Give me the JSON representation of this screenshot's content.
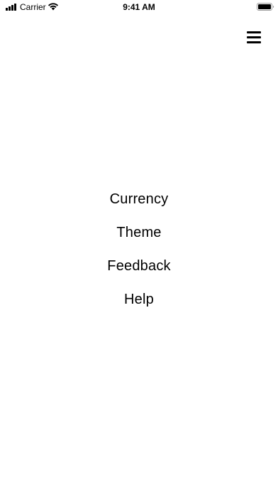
{
  "status_bar": {
    "carrier": "Carrier",
    "time": "9:41 AM",
    "icons": [
      "signal-icon",
      "wifi-icon",
      "battery-icon"
    ]
  },
  "header": {
    "menu_icon": "hamburger-menu-icon"
  },
  "menu": {
    "items": [
      {
        "label": "Currency"
      },
      {
        "label": "Theme"
      },
      {
        "label": "Feedback"
      },
      {
        "label": "Help"
      }
    ]
  },
  "colors": {
    "background": "#ffffff",
    "text": "#000000"
  }
}
